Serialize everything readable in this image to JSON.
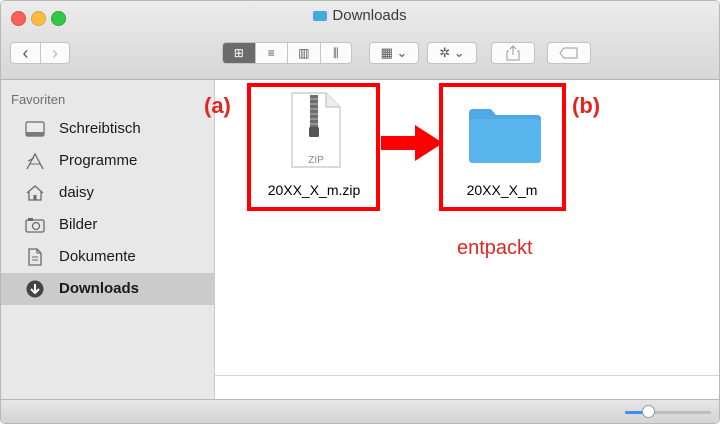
{
  "window": {
    "title": "Downloads"
  },
  "toolbar": {
    "back": "‹",
    "forward": "›",
    "view_modes": [
      "⊞",
      "≡",
      "▥",
      "⫼"
    ],
    "arrange": "▦ ⌄",
    "action": "✲ ⌄"
  },
  "sidebar": {
    "header": "Favoriten",
    "items": [
      {
        "label": "Schreibtisch",
        "icon": "desktop-icon"
      },
      {
        "label": "Programme",
        "icon": "applications-icon"
      },
      {
        "label": "daisy",
        "icon": "home-icon"
      },
      {
        "label": "Bilder",
        "icon": "camera-icon"
      },
      {
        "label": "Dokumente",
        "icon": "document-icon"
      },
      {
        "label": "Downloads",
        "icon": "download-icon",
        "selected": true
      }
    ]
  },
  "files": [
    {
      "name": "20XX_X_m.zip",
      "type_badge": "ZIP",
      "annotation": "(a)"
    },
    {
      "name": "20XX_X_m",
      "annotation": "(b)"
    }
  ],
  "annotation_note": "entpackt",
  "colors": {
    "highlight": "#ff0000",
    "folder": "#5ab4ee",
    "accent": "#3b8ff5",
    "annotation_text": "#e2261d"
  },
  "zoom_slider": {
    "level": 0.25
  }
}
